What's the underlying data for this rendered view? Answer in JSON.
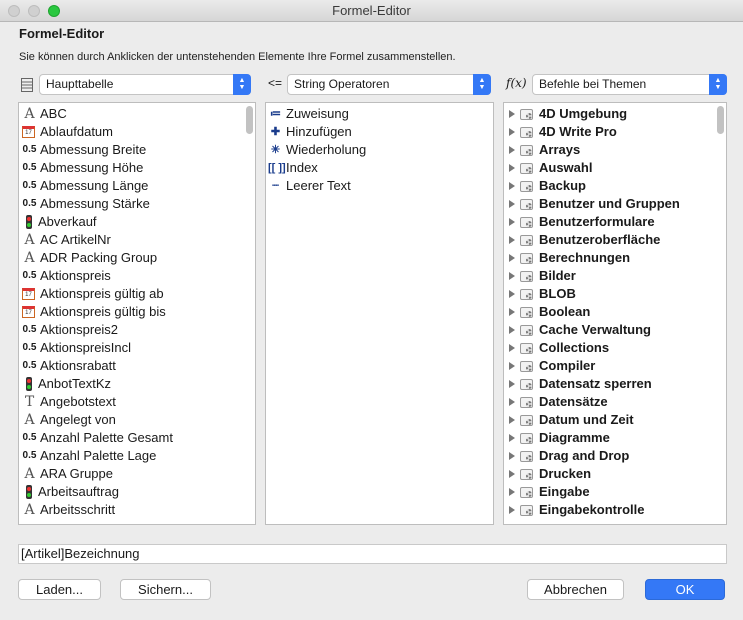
{
  "window": {
    "title": "Formel-Editor"
  },
  "header": {
    "title": "Formel-Editor",
    "description": "Sie können durch Anklicken der untenstehenden Elemente Ihre Formel zusammenstellen."
  },
  "selectors": {
    "table": "Haupttabelle",
    "operators_icon": "<=",
    "operators": "String Operatoren",
    "commands_icon": "f(x)",
    "commands": "Befehle bei Themen"
  },
  "fields": [
    {
      "icon": "alpha",
      "label": "ABC"
    },
    {
      "icon": "cal",
      "label": "Ablaufdatum"
    },
    {
      "icon": "num",
      "label": "Abmessung Breite"
    },
    {
      "icon": "num",
      "label": "Abmessung Höhe"
    },
    {
      "icon": "num",
      "label": "Abmessung Länge"
    },
    {
      "icon": "num",
      "label": "Abmessung Stärke"
    },
    {
      "icon": "bool",
      "label": "Abverkauf"
    },
    {
      "icon": "alpha",
      "label": "AC ArtikelNr"
    },
    {
      "icon": "alpha",
      "label": "ADR Packing Group"
    },
    {
      "icon": "num",
      "label": "Aktionspreis"
    },
    {
      "icon": "cal",
      "label": "Aktionspreis gültig ab"
    },
    {
      "icon": "cal",
      "label": "Aktionspreis gültig bis"
    },
    {
      "icon": "num",
      "label": "Aktionspreis2"
    },
    {
      "icon": "num",
      "label": "AktionspreisIncl"
    },
    {
      "icon": "num",
      "label": "Aktionsrabatt"
    },
    {
      "icon": "bool",
      "label": "AnbotTextKz"
    },
    {
      "icon": "text",
      "label": "Angebotstext"
    },
    {
      "icon": "alpha",
      "label": "Angelegt von"
    },
    {
      "icon": "num",
      "label": "Anzahl Palette Gesamt"
    },
    {
      "icon": "num",
      "label": "Anzahl Palette Lage"
    },
    {
      "icon": "alpha",
      "label": "ARA Gruppe"
    },
    {
      "icon": "bool",
      "label": "Arbeitsauftrag"
    },
    {
      "icon": "alpha",
      "label": "Arbeitsschritt"
    }
  ],
  "icon_glyphs": {
    "num": "0.5",
    "cal": "17",
    "text": "T",
    "alpha": "A"
  },
  "operators_list": [
    {
      "icon": "≔",
      "label": "Zuweisung"
    },
    {
      "icon": "✚",
      "label": "Hinzufügen"
    },
    {
      "icon": "✳",
      "label": "Wiederholung"
    },
    {
      "icon": "[[ ]]",
      "label": "Index"
    },
    {
      "icon": "┈",
      "label": "Leerer Text"
    }
  ],
  "themes": [
    "4D Umgebung",
    "4D Write Pro",
    "Arrays",
    "Auswahl",
    "Backup",
    "Benutzer und Gruppen",
    "Benutzerformulare",
    "Benutzeroberfläche",
    "Berechnungen",
    "Bilder",
    "BLOB",
    "Boolean",
    "Cache Verwaltung",
    "Collections",
    "Compiler",
    "Datensatz sperren",
    "Datensätze",
    "Datum und Zeit",
    "Diagramme",
    "Drag and Drop",
    "Drucken",
    "Eingabe",
    "Eingabekontrolle"
  ],
  "formula": "[Artikel]Bezeichnung",
  "buttons": {
    "load": "Laden...",
    "save": "Sichern...",
    "cancel": "Abbrechen",
    "ok": "OK"
  },
  "colors": {
    "accent": "#3478f6",
    "zoom": "#2ac840"
  }
}
